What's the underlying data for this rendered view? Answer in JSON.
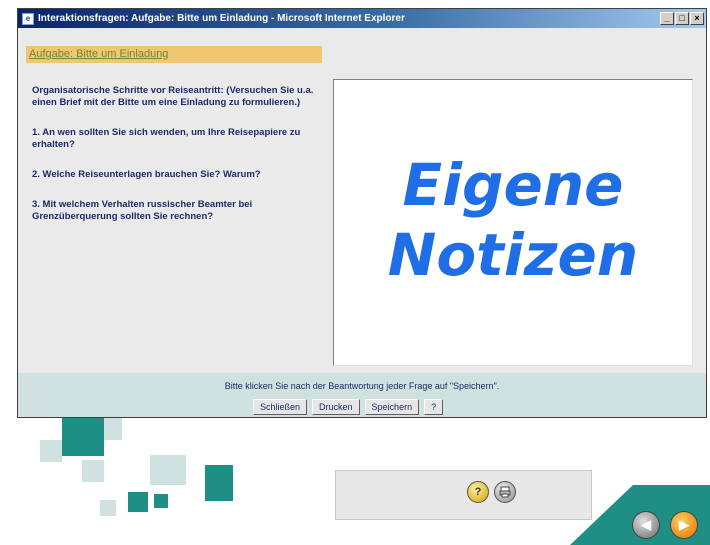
{
  "window": {
    "title": "Interaktionsfragen: Aufgabe: Bitte um Einladung - Microsoft Internet Explorer",
    "minimize": "_",
    "maximize": "□",
    "close": "×"
  },
  "task": {
    "header": "Aufgabe: Bitte um Einladung",
    "questions": [
      "Organisatorische Schritte vor Reiseantritt: (Versuchen Sie u.a. einen Brief mit der Bitte um eine Einladung zu formulieren.)",
      "1. An wen sollten Sie sich wenden, um Ihre Reisepapiere zu erhalten?",
      "2. Welche Reiseunterlagen brauchen Sie? Warum?",
      "3. Mit welchem Verhalten russischer Beamter bei Grenzüberquerung sollten Sie rechnen?"
    ]
  },
  "notes": {
    "line1": "Eigene",
    "line2": "Notizen"
  },
  "footer": {
    "instruction": "Bitte klicken Sie nach der Beantwortung jeder Frage auf \"Speichern\".",
    "buttons": {
      "close": "Schließen",
      "print": "Drucken",
      "save": "Speichern",
      "help": "?"
    }
  },
  "background": {
    "help_glyph": "?",
    "back_glyph": "◀",
    "forward_glyph": "▶"
  },
  "colors": {
    "teal": "#1f8f86",
    "notes_blue": "#1f6ee6",
    "header_orange": "#f1c572"
  }
}
